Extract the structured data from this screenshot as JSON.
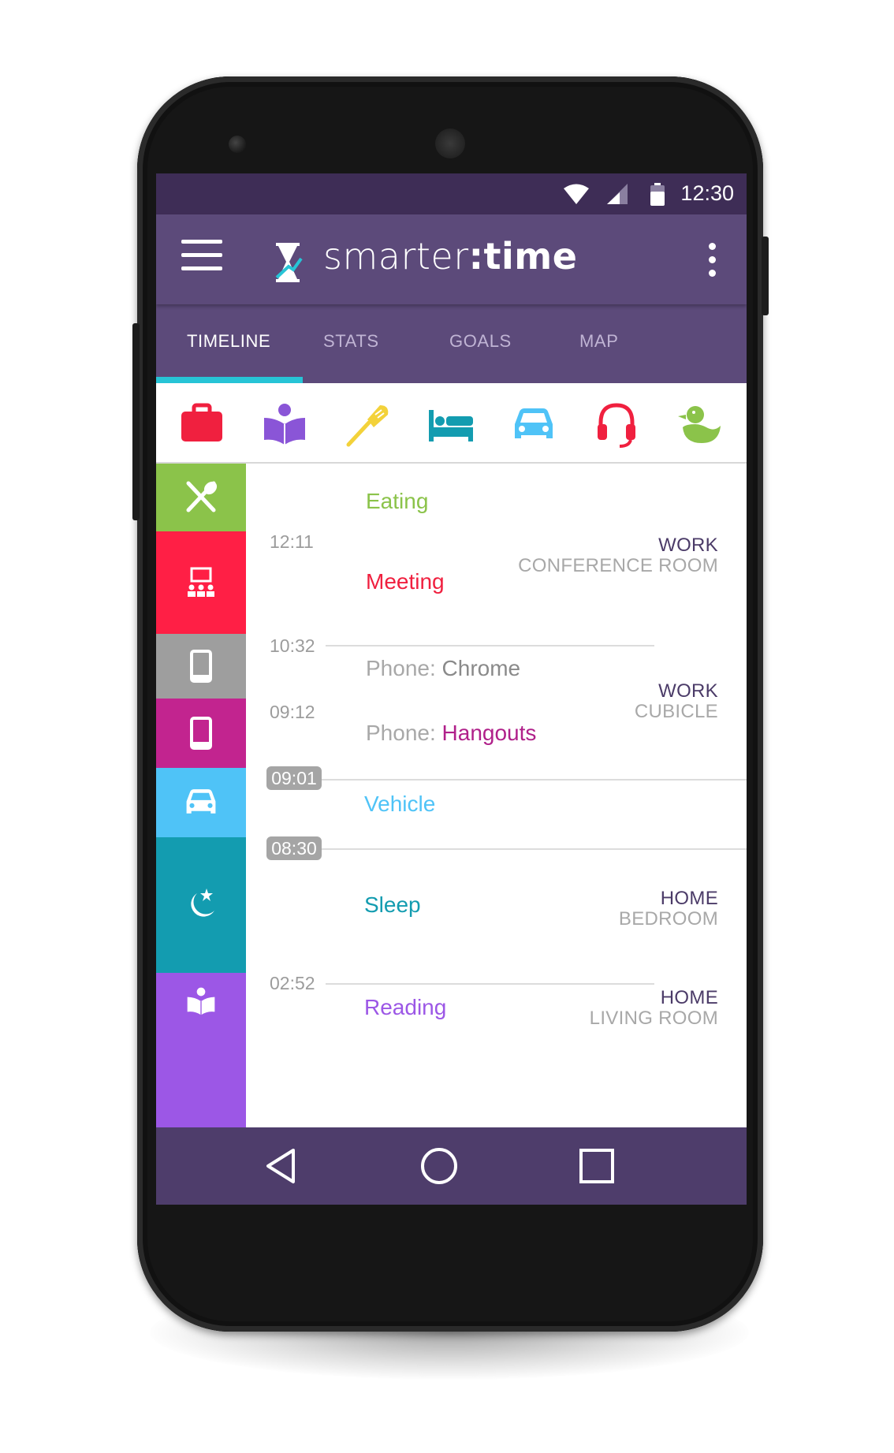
{
  "status_bar": {
    "time": "12:30"
  },
  "app_bar": {
    "logo_text_light": "smarter",
    "logo_text_bold": ":time"
  },
  "tabs": [
    {
      "label": "TIMELINE",
      "active": true
    },
    {
      "label": "STATS",
      "active": false
    },
    {
      "label": "GOALS",
      "active": false
    },
    {
      "label": "MAP",
      "active": false
    }
  ],
  "category_bar": [
    {
      "icon": "briefcase-icon",
      "color": "#f0203f"
    },
    {
      "icon": "reading-icon",
      "color": "#8a55d7"
    },
    {
      "icon": "spatula-icon",
      "color": "#f3d23a"
    },
    {
      "icon": "bed-icon",
      "color": "#139cb0"
    },
    {
      "icon": "car-icon",
      "color": "#4fc3f7"
    },
    {
      "icon": "headset-icon",
      "color": "#f0203f"
    },
    {
      "icon": "duck-icon",
      "color": "#8bc34a"
    }
  ],
  "timeline": {
    "blocks": [
      {
        "icon": "eating-icon",
        "color": "#8bc34a"
      },
      {
        "icon": "meeting-icon",
        "color": "#ff1f45"
      },
      {
        "icon": "phone-icon",
        "color": "#9e9e9e"
      },
      {
        "icon": "phone-icon",
        "color": "#c2248f"
      },
      {
        "icon": "car-icon",
        "color": "#4fc3f7"
      },
      {
        "icon": "sleep-icon",
        "color": "#139cb0"
      },
      {
        "icon": "reading-icon",
        "color": "#9c57e6"
      }
    ],
    "timestamps": [
      "12:11",
      "10:32",
      "09:12",
      "09:01",
      "08:30",
      "02:52"
    ],
    "activities": [
      {
        "name": "Eating",
        "color": "#8bc34a"
      },
      {
        "name": "Meeting",
        "color": "#f0203f"
      },
      {
        "prefix": "Phone:",
        "name": "Chrome",
        "color": "#8a8a8a"
      },
      {
        "prefix": "Phone:",
        "name": "Hangouts",
        "color": "#b0208a"
      },
      {
        "name": "Vehicle",
        "color": "#4fc3f7"
      },
      {
        "name": "Sleep",
        "color": "#139cb0"
      },
      {
        "name": "Reading",
        "color": "#9c57e6"
      }
    ],
    "locations": [
      {
        "place": "WORK",
        "room": "CONFERENCE ROOM"
      },
      {
        "place": "WORK",
        "room": "CUBICLE"
      },
      {
        "place": "HOME",
        "room": "BEDROOM"
      },
      {
        "place": "HOME",
        "room": "LIVING ROOM"
      }
    ]
  },
  "nav_bar": [
    "back-icon",
    "home-icon",
    "recents-icon"
  ]
}
